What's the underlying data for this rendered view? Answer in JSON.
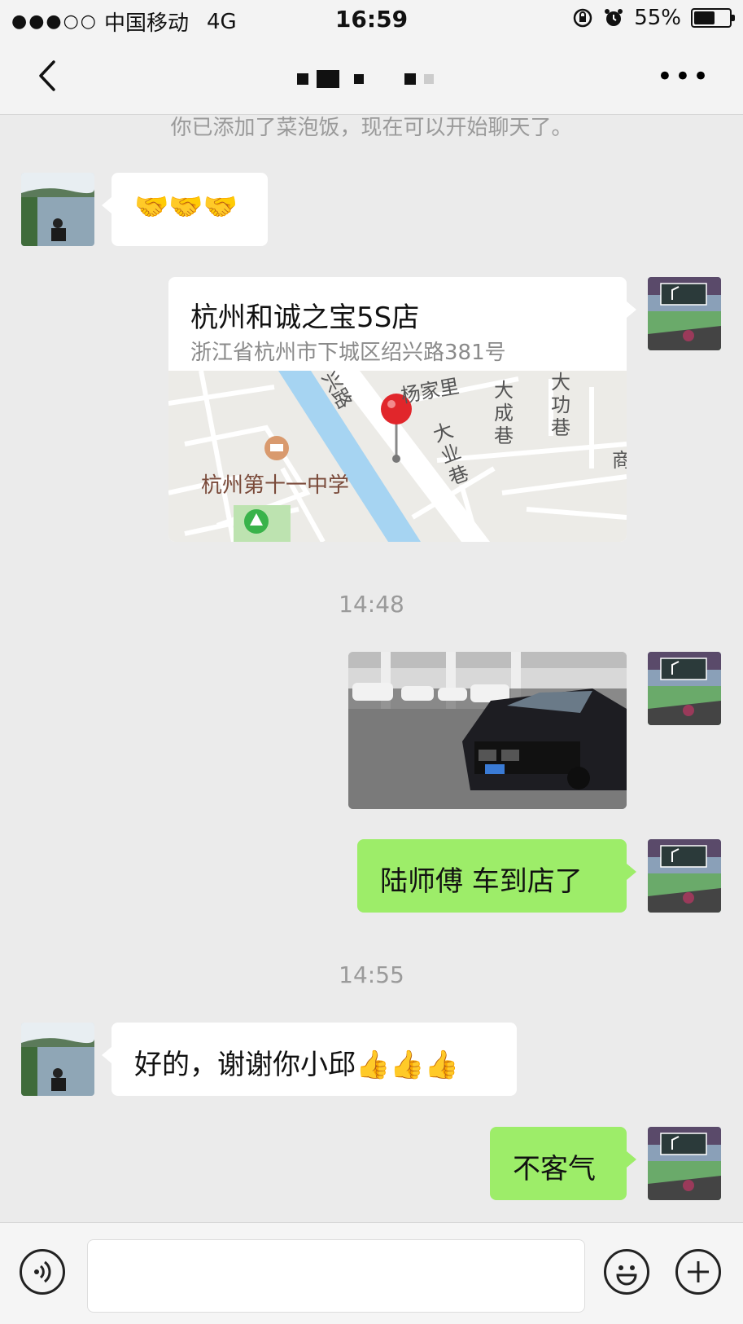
{
  "status_bar": {
    "signal_dots": "●●●○○",
    "carrier": "中国移动",
    "network": "4G",
    "time": "16:59",
    "battery": "55%"
  },
  "nav": {
    "back_icon": "chevron-left-icon",
    "more_icon": "more-horizontal-icon"
  },
  "system_notice": "你已添加了菜泡饭，现在可以开始聊天了。",
  "messages": [
    {
      "side": "left",
      "text": "🤝🤝🤝"
    },
    {
      "side": "right",
      "type": "location",
      "name": "杭州和诚之宝5S店",
      "address": "浙江省杭州市下城区绍兴路381号"
    },
    {
      "type": "timestamp",
      "text": "14:48"
    },
    {
      "side": "right",
      "type": "image"
    },
    {
      "side": "right",
      "text": "陆师傅 车到店了"
    },
    {
      "type": "timestamp",
      "text": "14:55"
    },
    {
      "side": "left",
      "text": "好的，谢谢你小邱👍👍👍"
    },
    {
      "side": "right",
      "text": "不客气"
    }
  ],
  "map_labels": {
    "road1": "兴路",
    "road2": "杨家里",
    "lane1": "大成巷",
    "lane2": "大功巷",
    "lane3": "大业巷",
    "school": "杭州第十一中学",
    "edge": "商"
  },
  "input_bar": {
    "voice_icon": "voice-icon",
    "emoji_icon": "emoji-icon",
    "plus_icon": "plus-icon"
  },
  "colors": {
    "background": "#ebebeb",
    "right_bubble": "#9ded69",
    "left_bubble": "#ffffff"
  }
}
